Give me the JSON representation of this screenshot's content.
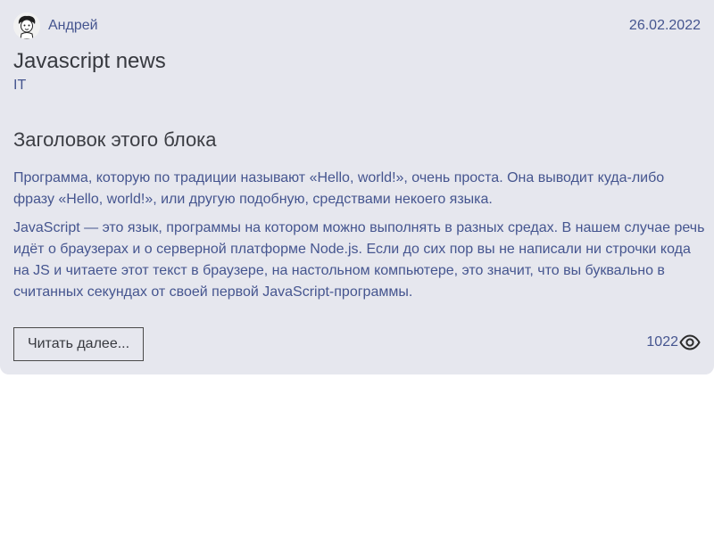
{
  "post": {
    "author": {
      "name": "Андрей",
      "avatar_icon": "cartoon-person-avatar-icon"
    },
    "date": "26.02.2022",
    "title": "Javascript news",
    "category": "IT",
    "block_heading": "Заголовок этого блока",
    "paragraphs": [
      "Программа, которую по традиции называют «Hello, world!», очень проста. Она выводит куда-либо фразу «Hello, world!», или другую подобную, средствами некоего языка.",
      "JavaScript — это язык, программы на котором можно выполнять в разных средах. В нашем случае речь идёт о браузерах и о серверной платформе Node.js. Если до сих пор вы не написали ни строчки кода на JS и читаете этот текст в браузере, на настольном компьютере, это значит, что вы буквально в считанных секундах от своей первой JavaScript-программы."
    ],
    "read_more_label": "Читать далее...",
    "views": "1022",
    "views_icon": "eye-icon"
  },
  "colors": {
    "card_background": "#e6e7ee",
    "accent_text": "#45558f",
    "heading_text": "#37393f"
  }
}
